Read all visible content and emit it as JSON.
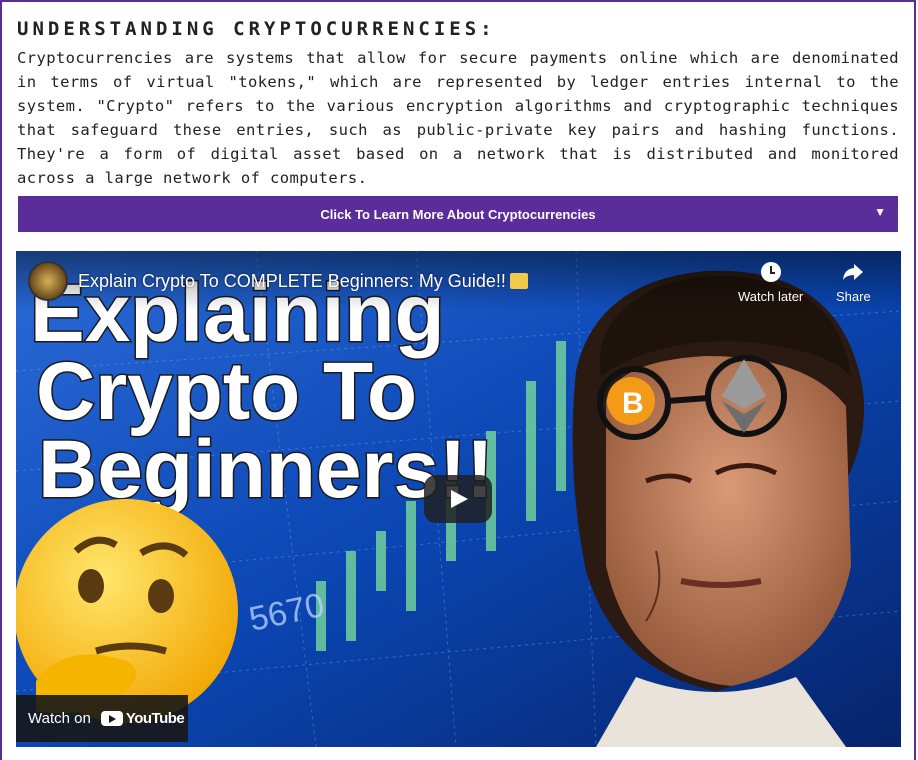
{
  "section": {
    "heading": "UNDERSTANDING CRYPTOCURRENCIES:",
    "paragraph": "Cryptocurrencies are systems that allow for secure payments online which are denominated in terms of virtual \"tokens,\" which are represented by ledger entries internal to the system. \"Crypto\" refers to the various encryption algorithms and cryptographic techniques that safeguard these entries, such as public-private key pairs and hashing functions. They're a form of digital asset based on a network that is distributed and monitored across a large network of computers."
  },
  "accordion": {
    "label": "Click To Learn More About Cryptocurrencies",
    "arrow": "▼"
  },
  "video": {
    "title": "Explain Crypto To COMPLETE Beginners: My Guide!!",
    "thumbnail_text": [
      "Explaining",
      "Crypto To",
      "Beginners!!"
    ],
    "chart_label": "5670",
    "watch_later_label": "Watch later",
    "share_label": "Share",
    "watch_on_label": "Watch on",
    "youtube_label": "YouTube",
    "colors": {
      "accent": "#5b2d9b",
      "thumbnail_bg": "#0a3a8c",
      "candle_green": "#7de39a"
    },
    "icons": [
      "clock-icon",
      "share-icon",
      "play-icon",
      "youtube-logo-icon"
    ]
  }
}
